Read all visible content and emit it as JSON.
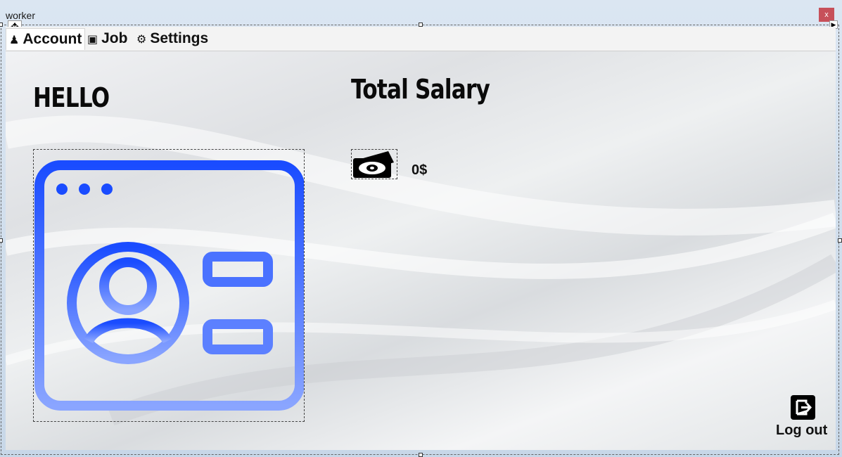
{
  "window": {
    "title": "worker",
    "close_label": "x"
  },
  "tabs": [
    {
      "label": "Account",
      "icon": "user-icon",
      "glyph": "♟"
    },
    {
      "label": "Job",
      "icon": "briefcase-icon",
      "glyph": "▣"
    },
    {
      "label": "Settings",
      "icon": "gear-icon",
      "glyph": "⚙"
    }
  ],
  "account": {
    "greeting": "HELLO",
    "salary_title": "Total Salary",
    "salary_value": "0$",
    "logout_label": "Log out"
  },
  "colors": {
    "accent": "#1a4cff",
    "close": "#c7505a"
  }
}
